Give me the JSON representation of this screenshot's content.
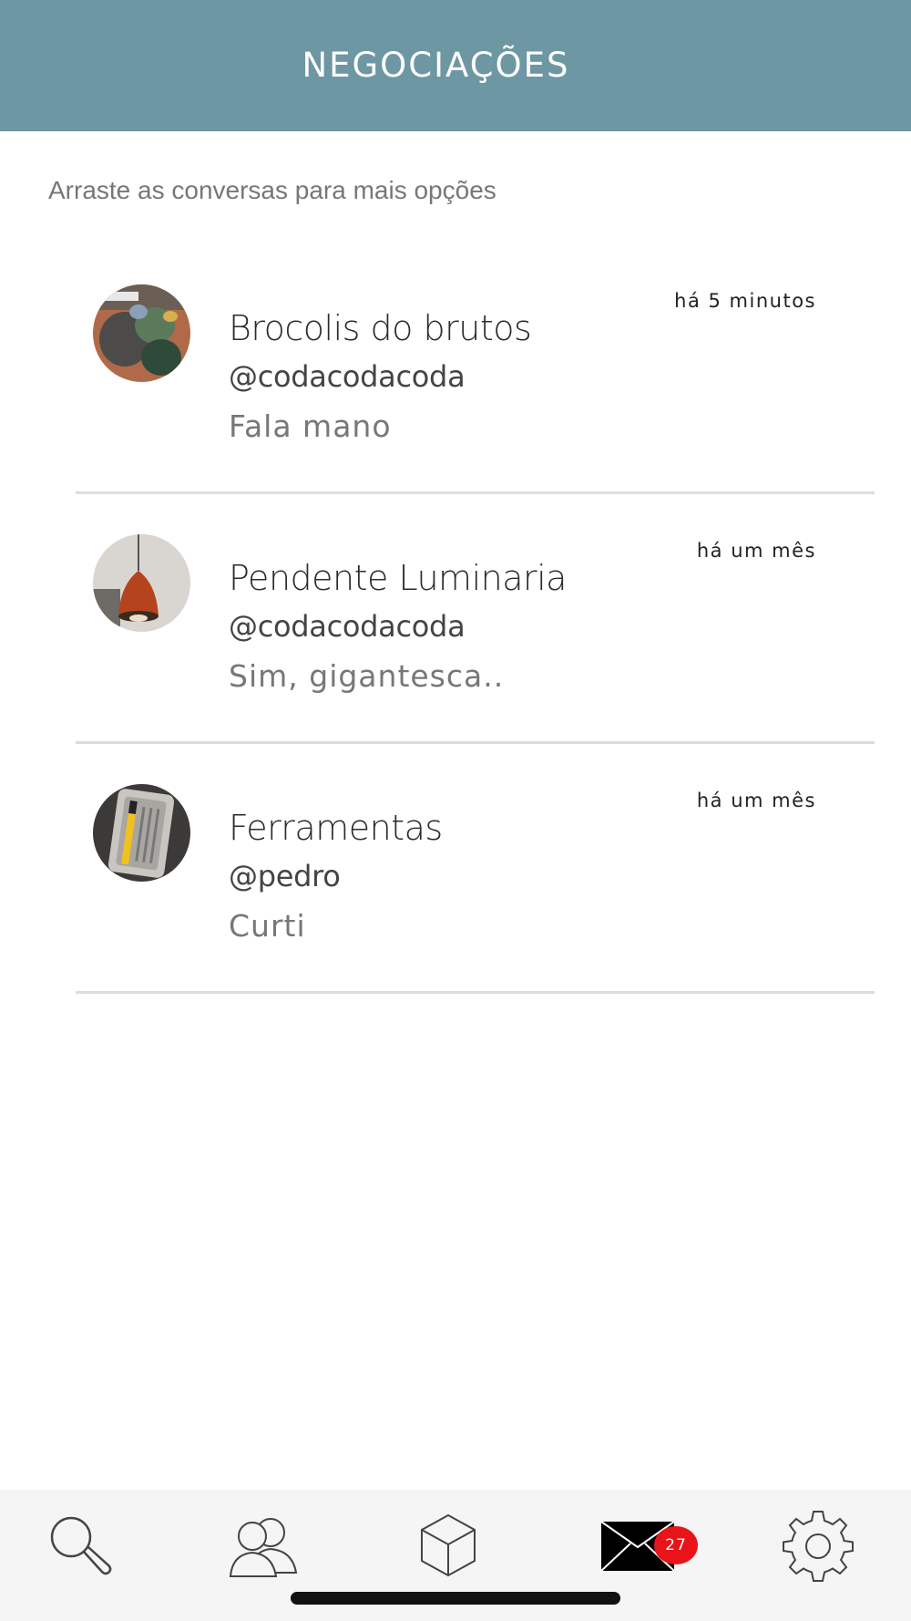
{
  "header": {
    "title": "NEGOCIAÇÕES"
  },
  "hint": "Arraste as conversas para mais opções",
  "conversations": [
    {
      "title": "Brocolis do brutos",
      "user": "@codacodacoda",
      "message": "Fala mano",
      "time": "há 5 minutos",
      "avatar": "brocolis-product-photo"
    },
    {
      "title": "Pendente Luminaria",
      "user": "@codacodacoda",
      "message": "Sim, gigantesca..",
      "time": "há um mês",
      "avatar": "pendant-lamp-photo"
    },
    {
      "title": "Ferramentas",
      "user": "@pedro",
      "message": "Curti",
      "time": "há um mês",
      "avatar": "tools-case-photo"
    }
  ],
  "tabbar": {
    "items": [
      {
        "icon": "search-icon"
      },
      {
        "icon": "users-icon"
      },
      {
        "icon": "box-icon"
      },
      {
        "icon": "mail-icon"
      },
      {
        "icon": "gear-icon"
      }
    ],
    "mail_badge": "27"
  },
  "colors": {
    "header_bg": "#6d97a2",
    "badge": "#e8141a",
    "divider": "#dcdcdc"
  }
}
